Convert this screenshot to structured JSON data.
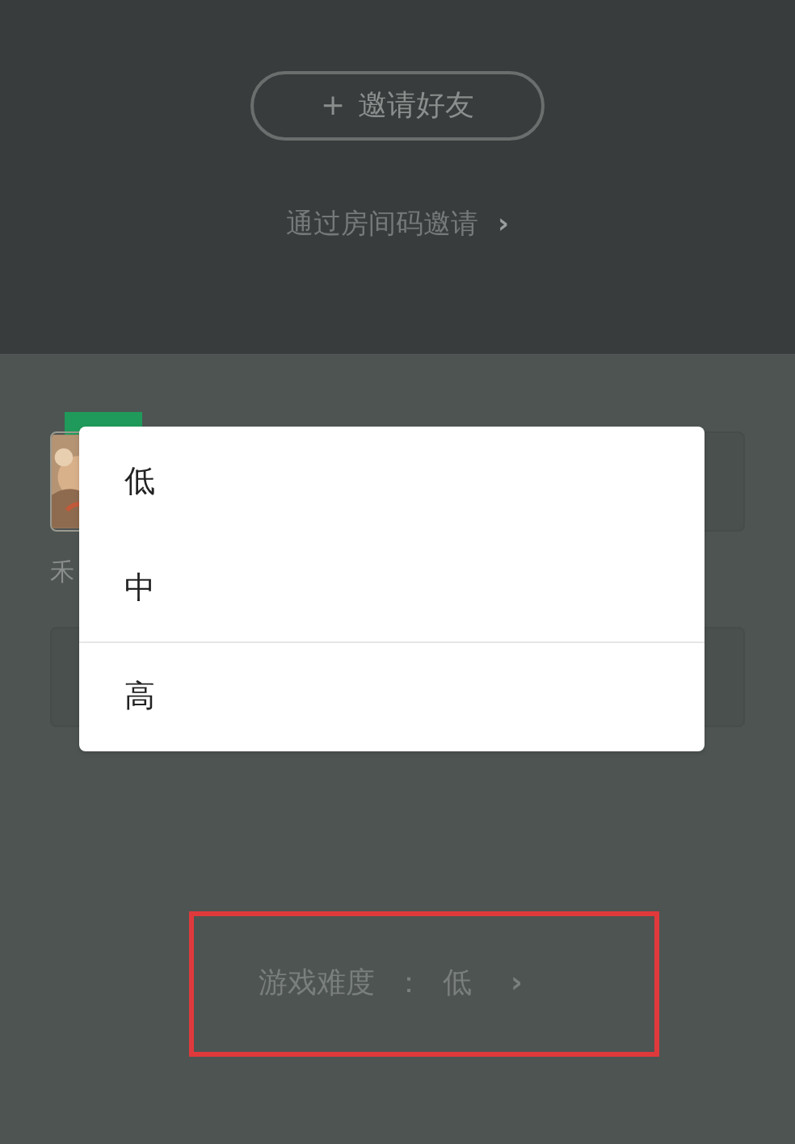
{
  "invite_button": {
    "icon": "+",
    "label": "邀请好友"
  },
  "room_code_link": {
    "label": "通过房间码邀请",
    "chevron": "›"
  },
  "player": {
    "name": "禾"
  },
  "difficulty_menu": {
    "options": [
      {
        "label": "低",
        "separated": false
      },
      {
        "label": "中",
        "separated": false
      },
      {
        "label": "高",
        "separated": true
      }
    ]
  },
  "difficulty_row": {
    "label": "游戏难度",
    "colon": "：",
    "value": "低",
    "chevron": "›"
  },
  "annotation": {
    "kind": "rectangle"
  }
}
